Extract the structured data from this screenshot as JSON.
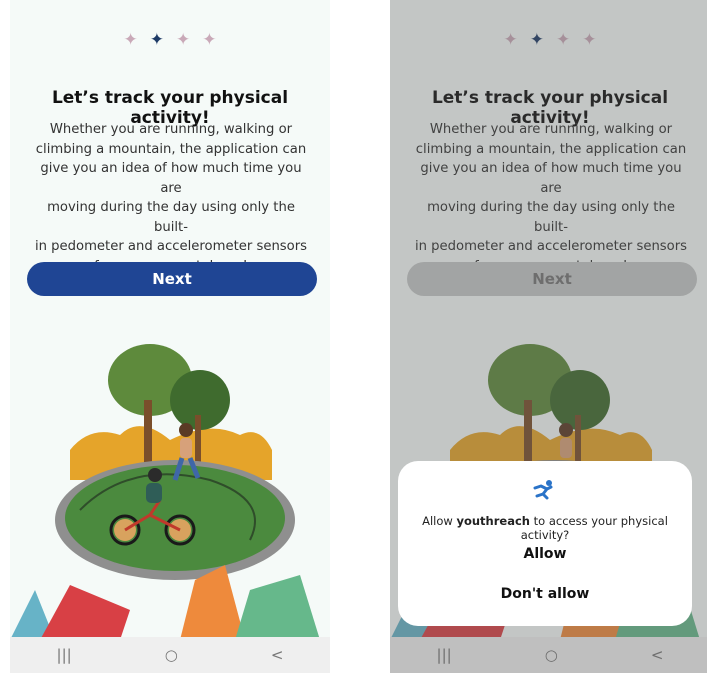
{
  "colors": {
    "primary": "#1f4594",
    "primary_disabled": "#c4c6c6",
    "background": "#f5faf8",
    "star_pink": "#c9a9b8",
    "star_active": "#1d3a66"
  },
  "onboarding": {
    "title": "Let’s track your physical activity!",
    "description": "Whether you are running, walking or\nclimbing a mountain, the application can\ngive you an idea of how much time you are\nmoving during the day using only the built-\nin pedometer and accelerometer sensors\nfrom your smartphone!",
    "next_label": "Next",
    "step_indicator": [
      "star-inactive",
      "star-active",
      "star-inactive",
      "star-inactive"
    ]
  },
  "permission_dialog": {
    "icon": "running-person-icon",
    "message_prefix": "Allow ",
    "app_name": "youthreach",
    "message_suffix": " to access your physical activity?",
    "allow_label": "Allow",
    "deny_label": "Don't allow"
  },
  "navbar": {
    "recents": "|||",
    "home": "○",
    "back": "<"
  }
}
